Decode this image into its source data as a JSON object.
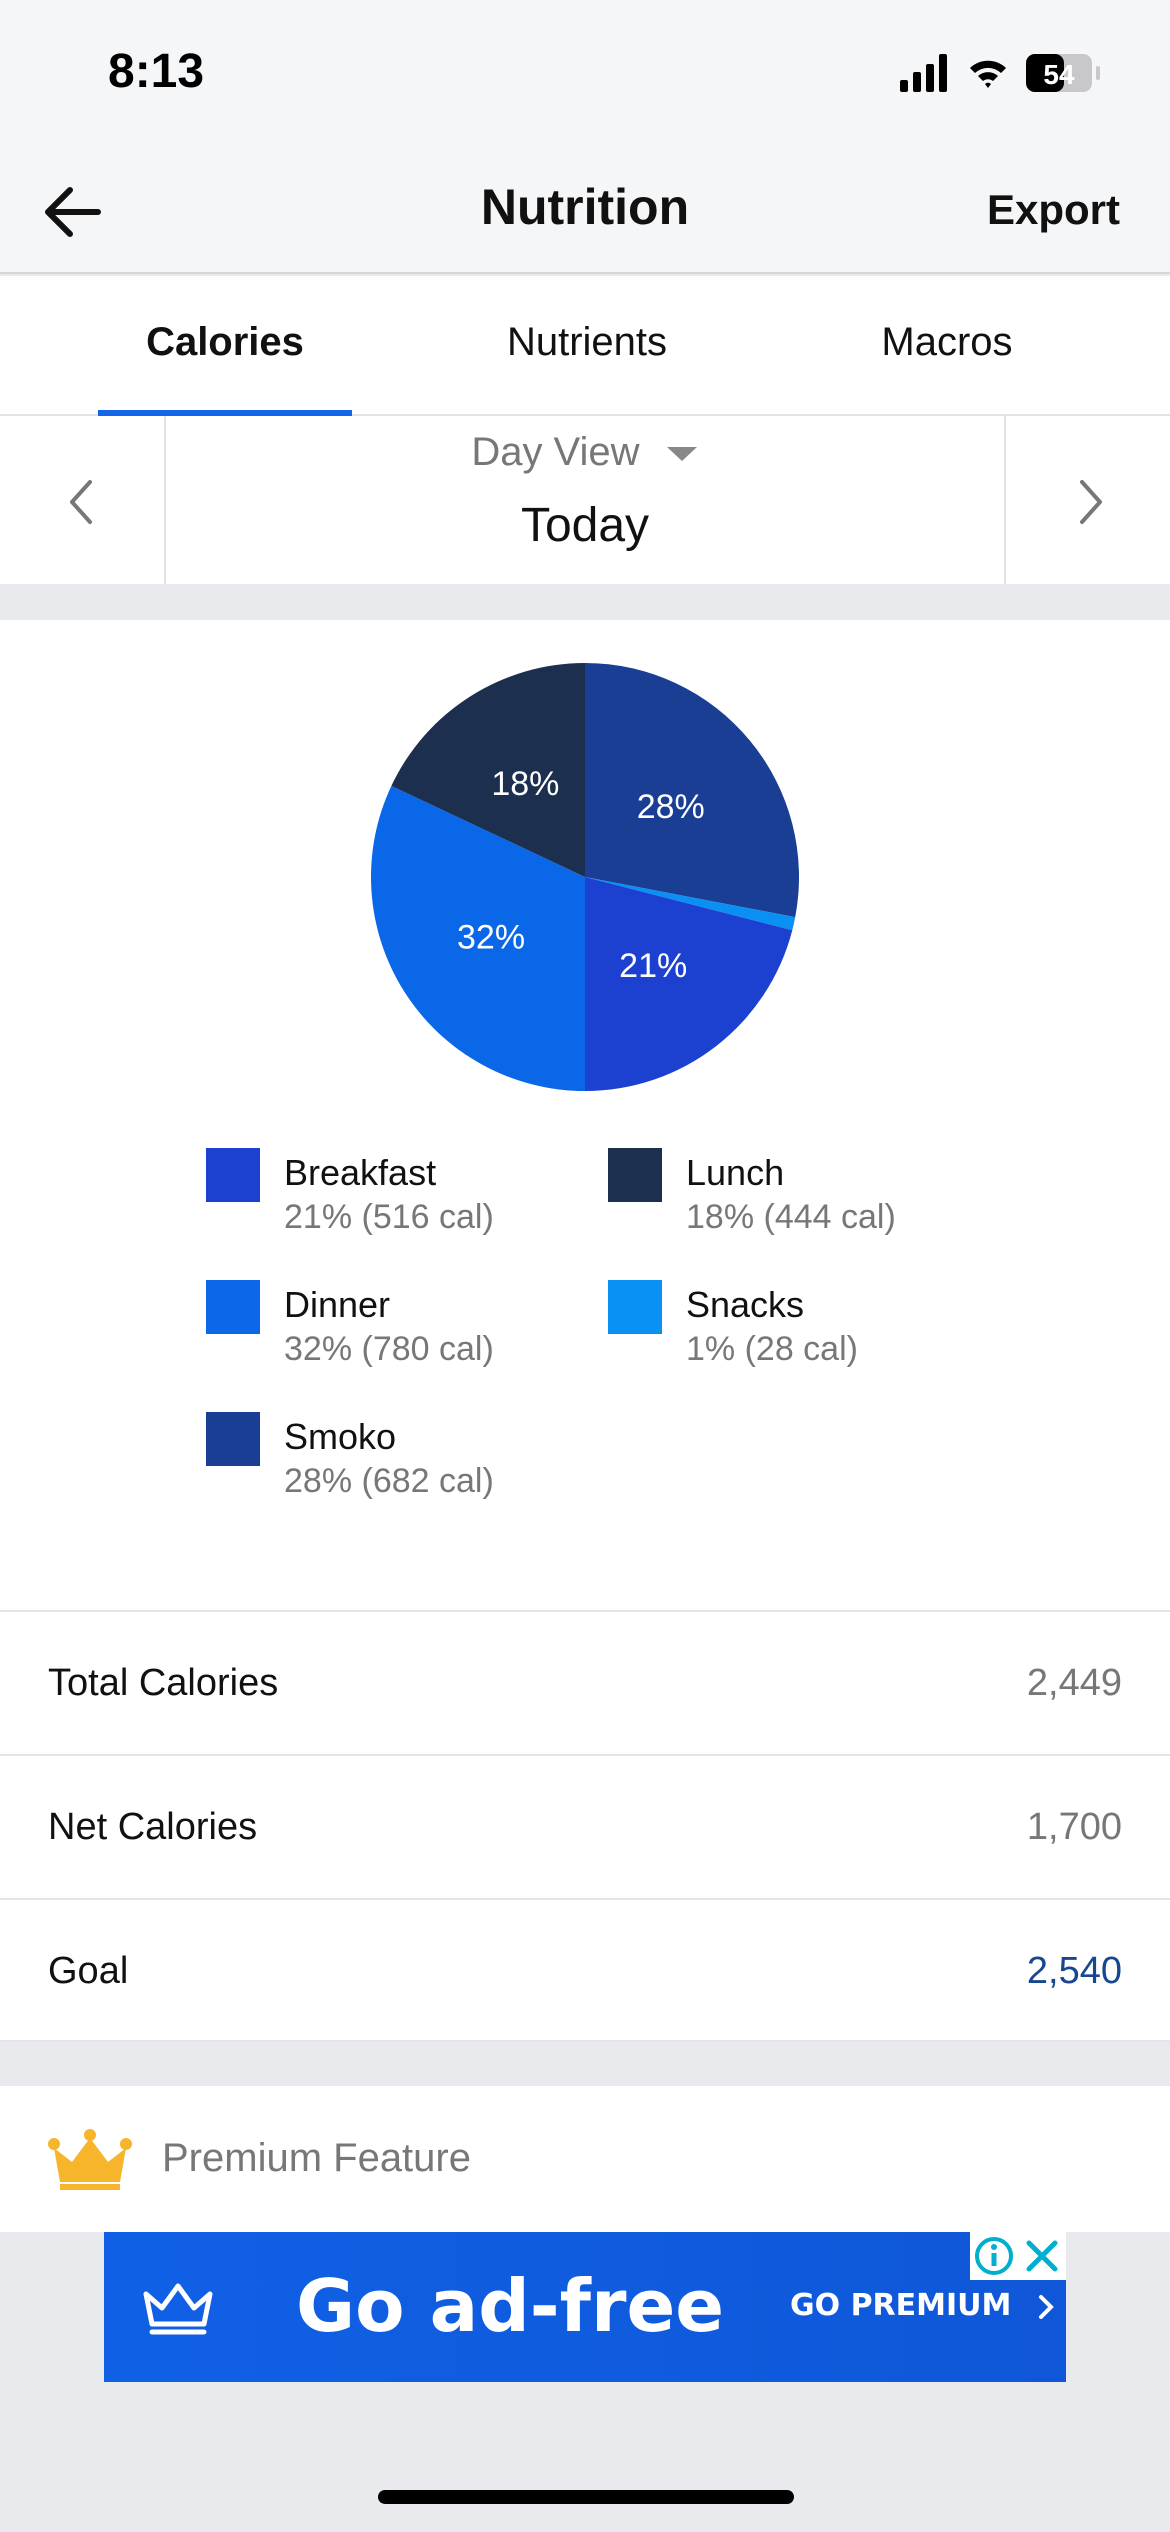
{
  "status_bar": {
    "time": "8:13",
    "battery": "54"
  },
  "nav": {
    "title": "Nutrition",
    "export_label": "Export",
    "back_icon": "arrow-left-icon"
  },
  "tabs": [
    {
      "label": "Calories",
      "active": true
    },
    {
      "label": "Nutrients",
      "active": false
    },
    {
      "label": "Macros",
      "active": false
    }
  ],
  "day_selector": {
    "view_label": "Day View",
    "current": "Today"
  },
  "legend": [
    {
      "name": "Breakfast",
      "value": "21% (516 cal)",
      "color": "#1c41d1"
    },
    {
      "name": "Lunch",
      "value": "18% (444 cal)",
      "color": "#1c2f4e"
    },
    {
      "name": "Dinner",
      "value": "32% (780 cal)",
      "color": "#0a67e8"
    },
    {
      "name": "Snacks",
      "value": "1% (28 cal)",
      "color": "#0a8ff2"
    },
    {
      "name": "Smoko",
      "value": "28% (682 cal)",
      "color": "#193e94"
    }
  ],
  "chart_data": {
    "type": "pie",
    "title": "",
    "slices": [
      {
        "name": "Smoko",
        "percent": 28,
        "calories": 682,
        "label": "28%",
        "color": "#193e94"
      },
      {
        "name": "Snacks",
        "percent": 1,
        "calories": 28,
        "label": "",
        "color": "#0a8ff2"
      },
      {
        "name": "Breakfast",
        "percent": 21,
        "calories": 516,
        "label": "21%",
        "color": "#1c41d1"
      },
      {
        "name": "Dinner",
        "percent": 32,
        "calories": 780,
        "label": "32%",
        "color": "#0a67e8"
      },
      {
        "name": "Lunch",
        "percent": 18,
        "calories": 444,
        "label": "18%",
        "color": "#1c2f4e"
      }
    ]
  },
  "summary": [
    {
      "label": "Total Calories",
      "value": "2,449",
      "highlight": false
    },
    {
      "label": "Net Calories",
      "value": "1,700",
      "highlight": false
    },
    {
      "label": "Goal",
      "value": "2,540",
      "highlight": true
    }
  ],
  "premium": {
    "label": "Premium Feature",
    "icon": "crown-icon"
  },
  "ad": {
    "headline": "Go ad-free",
    "cta": "GO PREMIUM"
  },
  "colors": {
    "accent": "#1466e8",
    "goal_blue": "#17478f",
    "crown": "#f6b52a"
  }
}
